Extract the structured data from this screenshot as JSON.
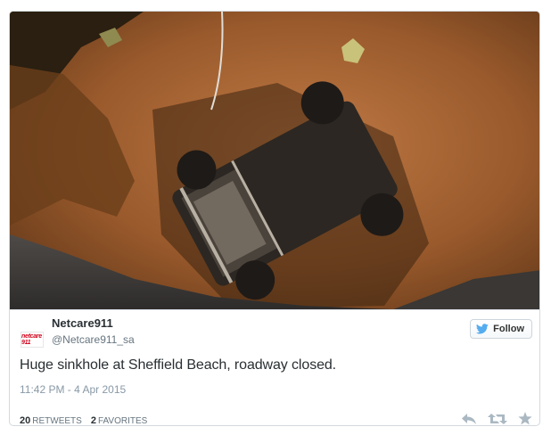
{
  "tweet": {
    "avatar_text": "netcare 911",
    "display_name": "Netcare911",
    "screen_name": "@Netcare911_sa",
    "follow_label": "Follow",
    "text": "Huge sinkhole at Sheffield Beach, roadway closed.",
    "timestamp": "11:42 PM - 4 Apr 2015",
    "retweets_count": "20",
    "retweets_label": "RETWEETS",
    "favorites_count": "2",
    "favorites_label": "FAVORITES"
  },
  "icons": {
    "follow": "twitter-bird-icon",
    "reply": "reply-icon",
    "retweet": "retweet-icon",
    "favorite": "star-icon"
  },
  "colors": {
    "brand_blue": "#55acee",
    "text_dark": "#292f33",
    "text_muted": "#8899a6",
    "action_gray": "#aab8c2"
  }
}
